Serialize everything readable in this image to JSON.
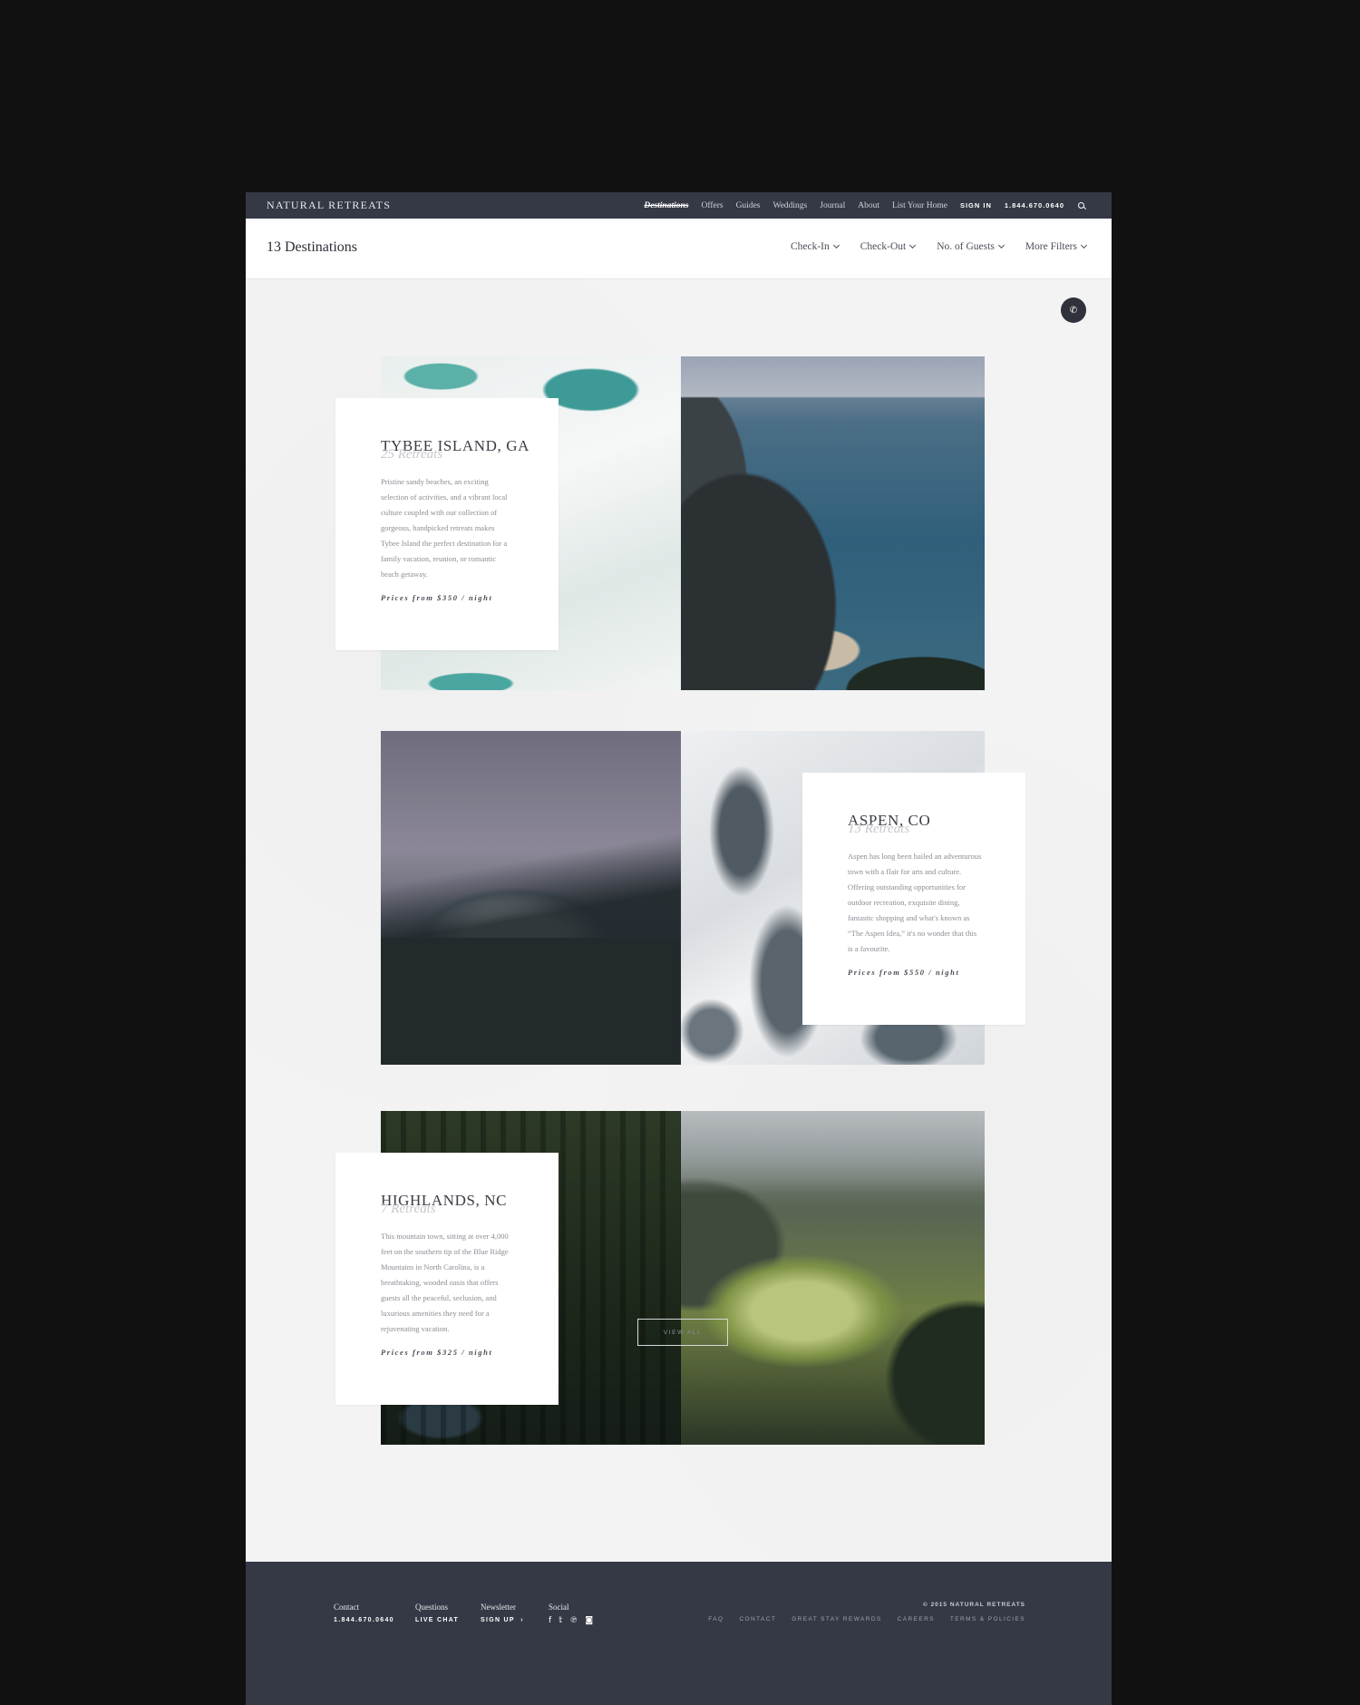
{
  "topbar": {
    "brand": "NATURAL RETREATS",
    "nav": [
      "Destinations",
      "Offers",
      "Guides",
      "Weddings",
      "Journal",
      "About",
      "List Your Home"
    ],
    "sign_in": "SIGN IN",
    "phone": "1.844.670.0640"
  },
  "filterbar": {
    "title": "13 Destinations",
    "filters": [
      "Check-In",
      "Check-Out",
      "No. of Guests",
      "More Filters"
    ]
  },
  "destinations": [
    {
      "name": "TYBEE ISLAND, GA",
      "count": "25 Retreats",
      "description": "Pristine sandy beaches, an exciting selection of activities, and a vibrant local culture coupled with our collection of gorgeous, handpicked retreats makes Tybee Island the perfect destination for a family vacation, reunion, or romantic beach getaway.",
      "price": "Prices from $350 / night"
    },
    {
      "name": "ASPEN, CO",
      "count": "13 Retreats",
      "description": "Aspen has long been hailed an adventurous town with a flair for arts and culture. Offering outstanding opportunities for outdoor recreation, exquisite dining, fantastic shopping and what's known as “The Aspen Idea,” it's no wonder that this is a favourite.",
      "price": "Prices from $550 / night"
    },
    {
      "name": "HIGHLANDS, NC",
      "count": "7 Retreats",
      "description": "This mountain town, sitting at over 4,000 feet on the southern tip of the Blue Ridge Mountains in North Carolina, is a breathtaking, wooded oasis that offers guests all the peaceful, seclusion, and luxurious amenities they need for a rejuvenating vacation.",
      "price": "Prices from $325 / night"
    }
  ],
  "view_all": "VIEW ALL",
  "footer": {
    "contact_label": "Contact",
    "contact_value": "1.844.670.0640",
    "questions_label": "Questions",
    "questions_value": "LIVE CHAT",
    "newsletter_label": "Newsletter",
    "newsletter_value": "SIGN UP",
    "social_label": "Social",
    "copyright": "© 2015 NATURAL RETREATS",
    "links": [
      "FAQ",
      "CONTACT",
      "GREAT STAY REWARDS",
      "CAREERS",
      "TERMS & POLICIES"
    ]
  }
}
